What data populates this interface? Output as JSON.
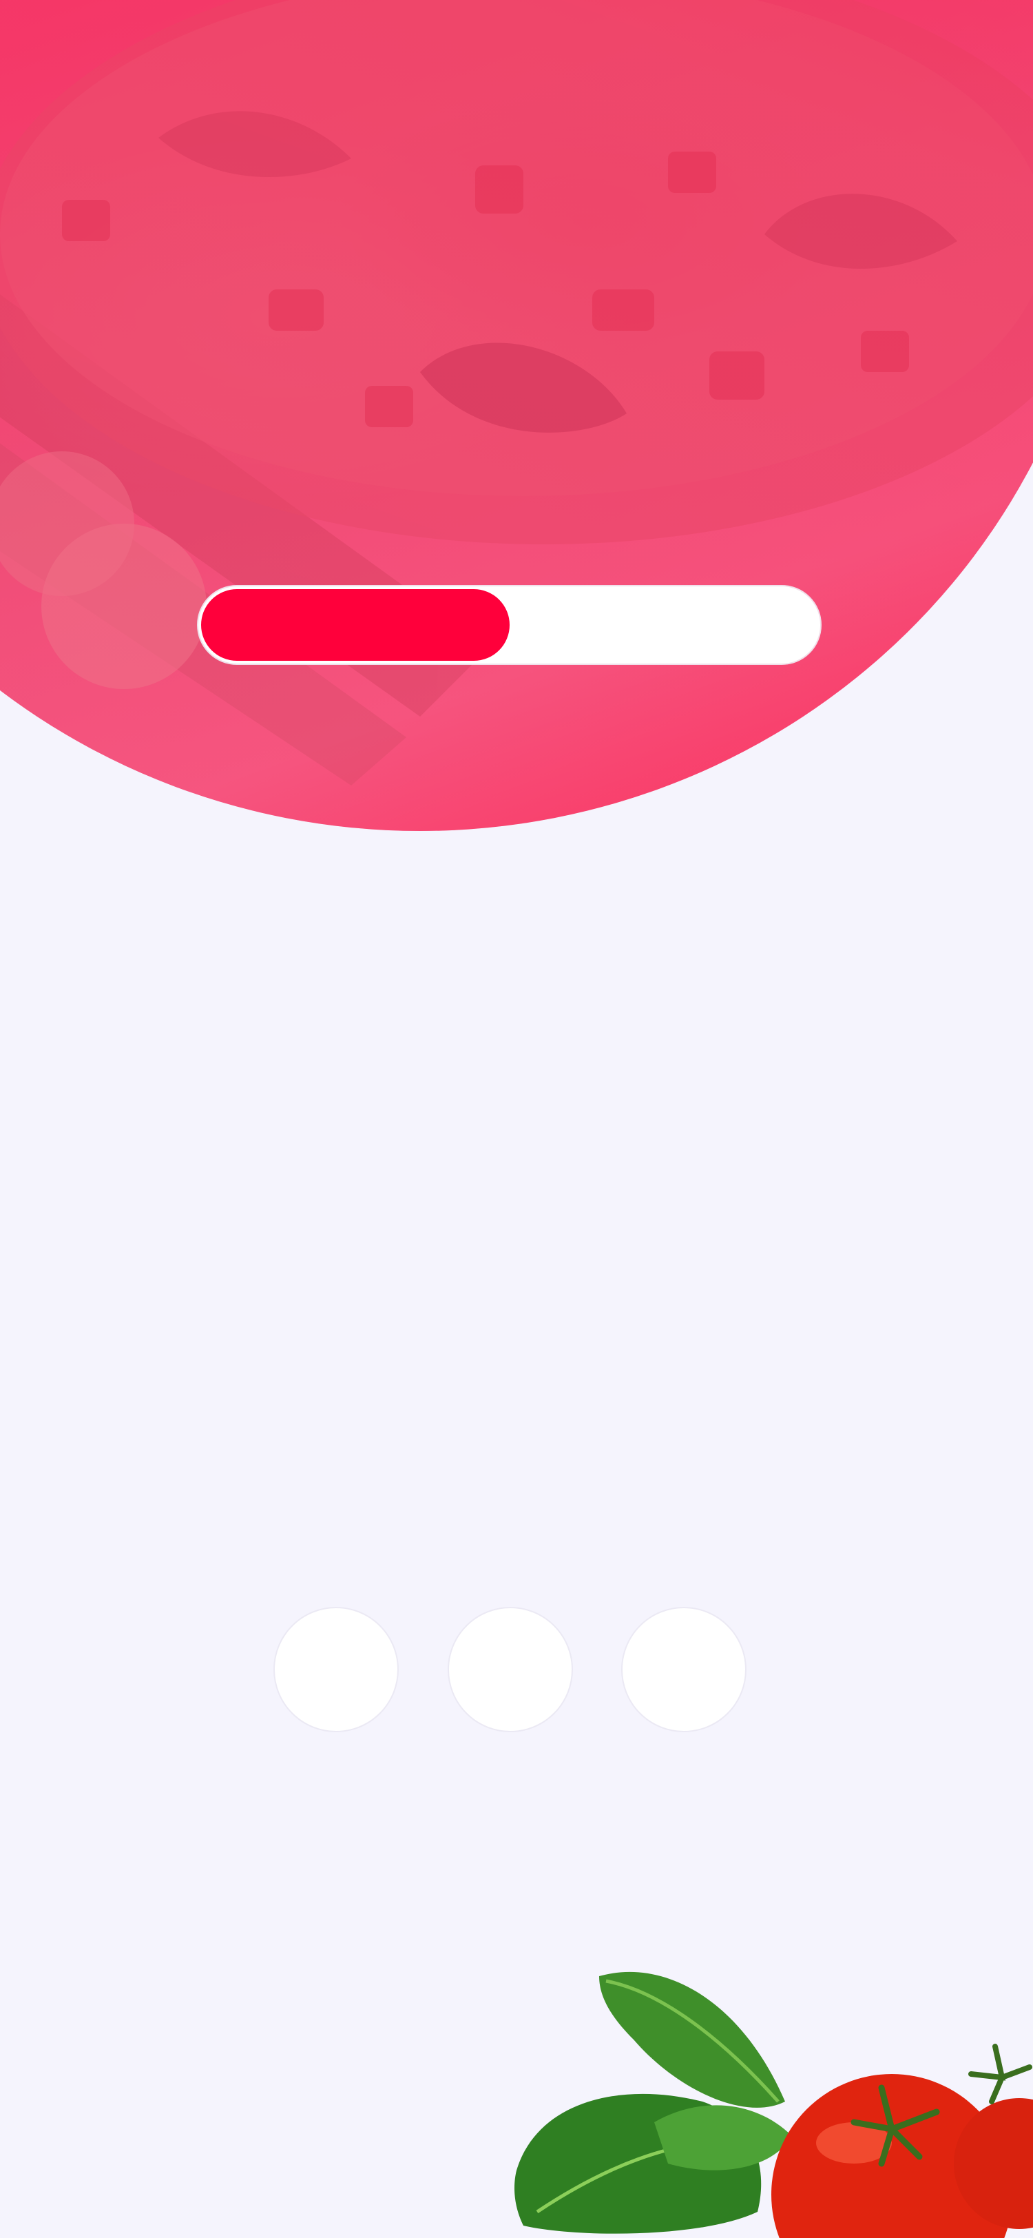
{
  "screen": {
    "background_color": "#f5f4fd",
    "hero_image": "pizza-photo",
    "hero_overlay_color": "#ff1e50",
    "decoration_image": "vegetables-tomato-basil"
  },
  "progress": {
    "value": 0.5,
    "fill_color": "#ff003b",
    "track_color": "#ffffff"
  },
  "pager_dots": {
    "count": 3
  }
}
